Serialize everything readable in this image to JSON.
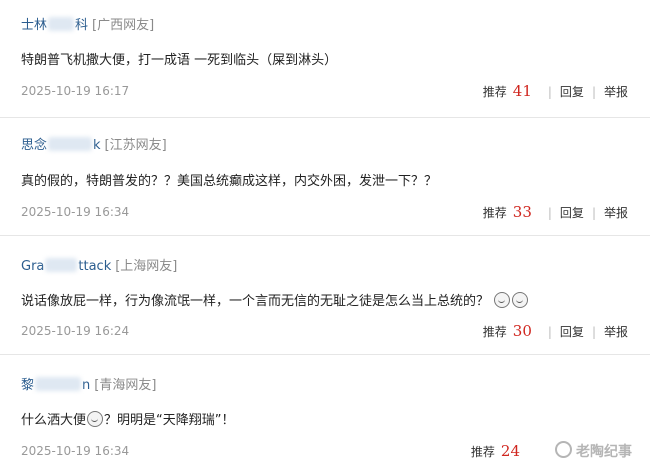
{
  "comments": [
    {
      "user_prefix": "士林",
      "user_suffix": "科",
      "region": "[广西网友]",
      "content": "特朗普飞机撒大便，打一成语 一死到临头（屎到淋头）",
      "time": "2025-10-19 16:17",
      "like_label": "推荐",
      "likes": "41",
      "reply_label": "回复",
      "report_label": "举报",
      "emojis": 0
    },
    {
      "user_prefix": "思念",
      "user_suffix": "k",
      "region": "[江苏网友]",
      "content": "真的假的，特朗普发的？？美国总统癫成这样，内交外困，发泄一下？？",
      "time": "2025-10-19 16:34",
      "like_label": "推荐",
      "likes": "33",
      "reply_label": "回复",
      "report_label": "举报",
      "emojis": 0
    },
    {
      "user_prefix": "Gra",
      "user_suffix": "ttack",
      "region": "[上海网友]",
      "content": "说话像放屁一样，行为像流氓一样，一个言而无信的无耻之徒是怎么当上总统的？",
      "time": "2025-10-19 16:24",
      "like_label": "推荐",
      "likes": "30",
      "reply_label": "回复",
      "report_label": "举报",
      "emojis": 2
    },
    {
      "user_prefix": "黎",
      "user_suffix": "n",
      "region": "[青海网友]",
      "content_before": "什么洒大便",
      "content_after": "？明明是“天降翔瑞”！",
      "time": "2025-10-19 16:34",
      "like_label": "推荐",
      "likes": "24",
      "reply_label": "回复",
      "report_label": "举报",
      "emojis": 1
    }
  ],
  "watermark": "老陶纪事",
  "colors": {
    "username": "#2b5d8f",
    "region": "#8a8a8a",
    "likes": "#d0261f",
    "time": "#999999"
  },
  "icons": {
    "emoji": "emoji-face-icon",
    "watermark": "watermark-logo-icon"
  }
}
